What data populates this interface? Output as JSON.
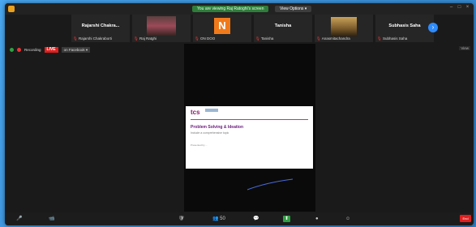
{
  "window": {
    "viewing_banner": "You are viewing Raj Ratoghi's screen",
    "view_options": "View Options ▾"
  },
  "participants": [
    {
      "name": "Rajarshi  Chakra...",
      "caption": "Rajarshi Chakraborti"
    },
    {
      "name": "",
      "caption": "Raj Ratghi"
    },
    {
      "name": "N",
      "caption": "ON DOO"
    },
    {
      "name": "Tanisha",
      "caption": "Tanisha"
    },
    {
      "name": "",
      "caption": "Anasmitachandra"
    },
    {
      "name": "Subhasis Saha",
      "caption": "Subhasis Saha"
    }
  ],
  "recording": {
    "label": "Recording",
    "live": "LIVE",
    "live_where": "on Facebook ▾"
  },
  "view_label": "View",
  "slide": {
    "logo": "tcs",
    "title": "Problem Solving & Ideation",
    "subtitle": "Include a comprehensive topic",
    "presenter": "Presented by ..."
  },
  "toolbar": {
    "mute": "🎤",
    "video": "📹",
    "security": "🛡",
    "participants": "👥 50",
    "chat": "💬",
    "share": "⬆",
    "record": "●",
    "reactions": "☺",
    "end": "End"
  },
  "colors": {
    "accent": "#2d8cff",
    "live_red": "#e02020",
    "share_green": "#2ea043",
    "avatar_orange": "#f07a1a"
  }
}
